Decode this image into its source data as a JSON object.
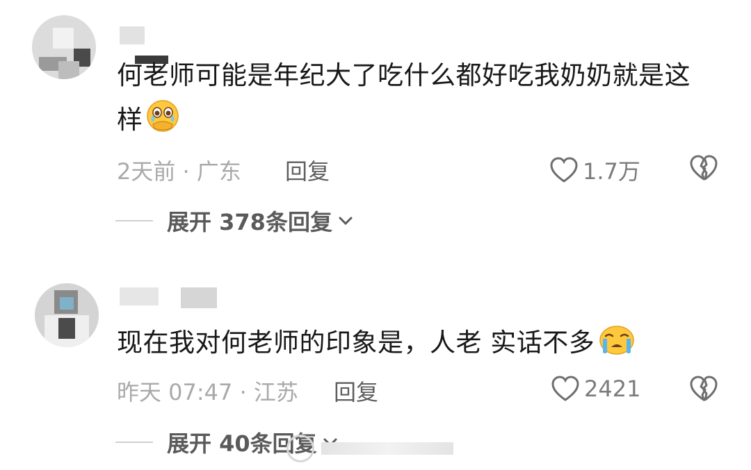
{
  "comments": [
    {
      "text": "何老师可能是年纪大了吃什么都好吃我奶奶就是这样",
      "emoji": "holding-back-tears-emoji",
      "meta": "2天前 · 广东",
      "reply_label": "回复",
      "likes": "1.7万",
      "expand_label": "展开 378条回复"
    },
    {
      "text": "现在我对何老师的印象是，人老 实话不多",
      "emoji": "loudly-crying-emoji",
      "meta": "昨天 07:47 · 江苏",
      "reply_label": "回复",
      "likes": "2421",
      "expand_label": "展开 40条回复"
    }
  ],
  "colors": {
    "meta_text": "#a9a9a9",
    "reply_text": "#5e5e5e",
    "emoji_yellow": "#ffc83d"
  }
}
